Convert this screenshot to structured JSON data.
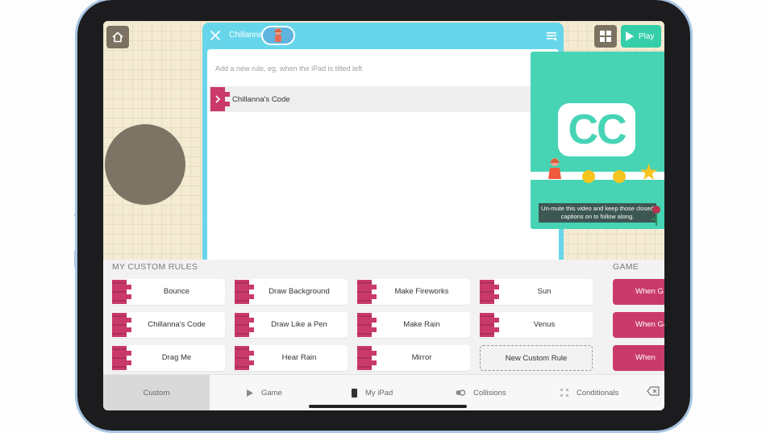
{
  "header": {
    "title": "Chillanna",
    "play_label": "Play",
    "rule_placeholder": "Add a new rule, eg. when the iPad is tilted left"
  },
  "editor": {
    "rule_row_label": "Chillanna's Code"
  },
  "video": {
    "cc_text": "CC",
    "caption": "Un-mute this video and keep those closed captions on to follow along."
  },
  "custom_rules": {
    "section_title": "MY CUSTOM RULES",
    "items": [
      {
        "label": "Bounce"
      },
      {
        "label": "Draw Background"
      },
      {
        "label": "Make Fireworks"
      },
      {
        "label": "Sun"
      },
      {
        "label": "Chillanna's Code"
      },
      {
        "label": "Draw Like a Pen"
      },
      {
        "label": "Make Rain"
      },
      {
        "label": "Venus"
      },
      {
        "label": "Drag Me"
      },
      {
        "label": "Hear Rain"
      },
      {
        "label": "Mirror"
      },
      {
        "label": "New Custom Rule"
      }
    ]
  },
  "game_rules": {
    "section_title": "GAME",
    "items": [
      {
        "label": "When G"
      },
      {
        "label": "When Ga"
      },
      {
        "label": "When"
      }
    ]
  },
  "tabs": [
    {
      "label": "Custom",
      "icon": "none",
      "active": true
    },
    {
      "label": "Game",
      "icon": "play-icon",
      "active": false
    },
    {
      "label": "My iPad",
      "icon": "ipad-icon",
      "active": false
    },
    {
      "label": "Collisions",
      "icon": "collisions-icon",
      "active": false
    },
    {
      "label": "Conditionals",
      "icon": "conditionals-icon",
      "active": false
    }
  ],
  "colors": {
    "accent_teal": "#67d6ea",
    "rule_pink": "#c93a6b",
    "play_green": "#34cfa8",
    "video_bg": "#46d4b5",
    "frame_blue": "#a9c5e3"
  }
}
